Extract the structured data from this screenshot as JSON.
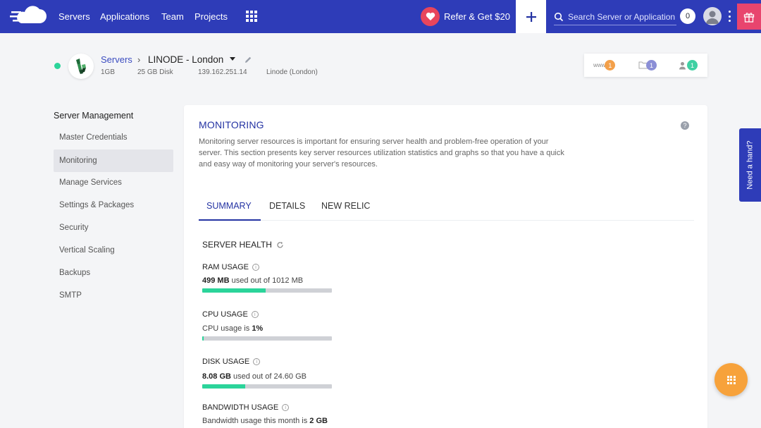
{
  "topbar": {
    "nav": [
      "Servers",
      "Applications",
      "Team",
      "Projects"
    ],
    "refer_label": "Refer & Get $20",
    "search_placeholder": "Search Server or Application",
    "notif_count": "0"
  },
  "server": {
    "crumb_servers": "Servers",
    "crumb_name": "LINODE - London",
    "ram": "1GB",
    "disk": "25 GB Disk",
    "ip": "139.162.251.14",
    "location": "Linode (London)",
    "stats": [
      {
        "label": "www",
        "count": "1",
        "color": "#f3a04a"
      },
      {
        "label": "folder",
        "count": "1",
        "color": "#8b8fd6"
      },
      {
        "label": "user",
        "count": "1",
        "color": "#3fd0a3"
      }
    ]
  },
  "sidebar": {
    "title": "Server Management",
    "items": [
      "Master Credentials",
      "Monitoring",
      "Manage Services",
      "Settings & Packages",
      "Security",
      "Vertical Scaling",
      "Backups",
      "SMTP"
    ],
    "active_index": 1
  },
  "panel": {
    "title": "MONITORING",
    "description": "Monitoring server resources is important for ensuring server health and problem-free operation of your server. This section presents key server resources utilization statistics and graphs so that you have a quick and easy way of monitoring your server's resources.",
    "tabs": [
      "SUMMARY",
      "DETAILS",
      "NEW RELIC"
    ],
    "section_title": "SERVER HEALTH",
    "metrics": {
      "ram": {
        "label": "RAM USAGE",
        "value": "499 MB",
        "suffix": " used out of 1012 MB",
        "fraction": 0.49
      },
      "cpu": {
        "label": "CPU USAGE",
        "prefix": "CPU usage is ",
        "value": "1%",
        "fraction": 0.01
      },
      "disk": {
        "label": "DISK USAGE",
        "value": "8.08 GB",
        "suffix": " used out of 24.60 GB",
        "fraction": 0.33
      },
      "bandwidth": {
        "label": "BANDWIDTH USAGE",
        "prefix": "Bandwidth usage this month is ",
        "value": "2 GB"
      }
    }
  },
  "widgets": {
    "need_hand": "Need a hand?"
  },
  "colors": {
    "brand": "#2e3cb8",
    "accent_green": "#2bd49a",
    "fab_orange": "#f7a23b"
  }
}
